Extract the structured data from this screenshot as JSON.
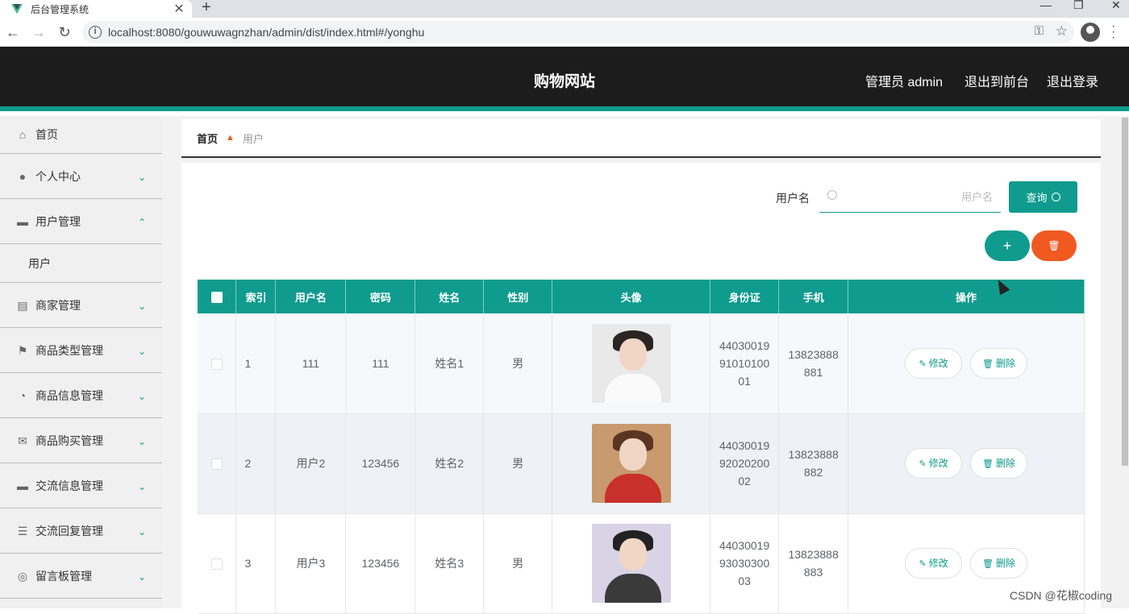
{
  "browser": {
    "tab_title": "后台管理系统",
    "tab_close": "✕",
    "new_tab": "+",
    "url": "localhost:8080/gouwuwagnzhan/admin/dist/index.html#/yonghu"
  },
  "header": {
    "site_title": "购物网站",
    "admin_label": "管理员 admin",
    "exit_front": "退出到前台",
    "logout": "退出登录"
  },
  "sidebar": {
    "items": [
      {
        "label": "首页",
        "icon": "home-icon"
      },
      {
        "label": "个人中心",
        "icon": "user-icon"
      },
      {
        "label": "用户管理",
        "icon": "users-icon",
        "expanded": true
      },
      {
        "label": "商家管理",
        "icon": "shop-icon"
      },
      {
        "label": "商品类型管理",
        "icon": "flag-icon"
      },
      {
        "label": "商品信息管理",
        "icon": "gauge-icon"
      },
      {
        "label": "商品购买管理",
        "icon": "mail-icon"
      },
      {
        "label": "交流信息管理",
        "icon": "chat-icon"
      },
      {
        "label": "交流回复管理",
        "icon": "sliders-icon"
      },
      {
        "label": "留言板管理",
        "icon": "target-icon"
      }
    ],
    "sub_item": "用户"
  },
  "breadcrumb": {
    "home": "首页",
    "current": "用户"
  },
  "search": {
    "label": "用户名",
    "placeholder": "用户名",
    "button": "查询"
  },
  "actions": {
    "add": "+",
    "delete": "🗑"
  },
  "table": {
    "headers": [
      "索引",
      "用户名",
      "密码",
      "姓名",
      "性别",
      "头像",
      "身份证",
      "手机",
      "操作"
    ],
    "rows": [
      {
        "index": "1",
        "username": "111",
        "password": "111",
        "name": "姓名1",
        "gender": "男",
        "id_line1": "44030019",
        "id_line2": "91010100",
        "id_line3": "01",
        "phone_line1": "13823888",
        "phone_line2": "881"
      },
      {
        "index": "2",
        "username": "用户2",
        "password": "123456",
        "name": "姓名2",
        "gender": "男",
        "id_line1": "44030019",
        "id_line2": "92020200",
        "id_line3": "02",
        "phone_line1": "13823888",
        "phone_line2": "882"
      },
      {
        "index": "3",
        "username": "用户3",
        "password": "123456",
        "name": "姓名3",
        "gender": "男",
        "id_line1": "44030019",
        "id_line2": "93030300",
        "id_line3": "03",
        "phone_line1": "13823888",
        "phone_line2": "883"
      }
    ],
    "edit_label": "修改",
    "delete_label": "删除"
  },
  "watermark": "CSDN @花椒coding",
  "colors": {
    "accent": "#0f9b8e",
    "danger": "#f05a20",
    "header_bg": "#1c1c1c"
  }
}
